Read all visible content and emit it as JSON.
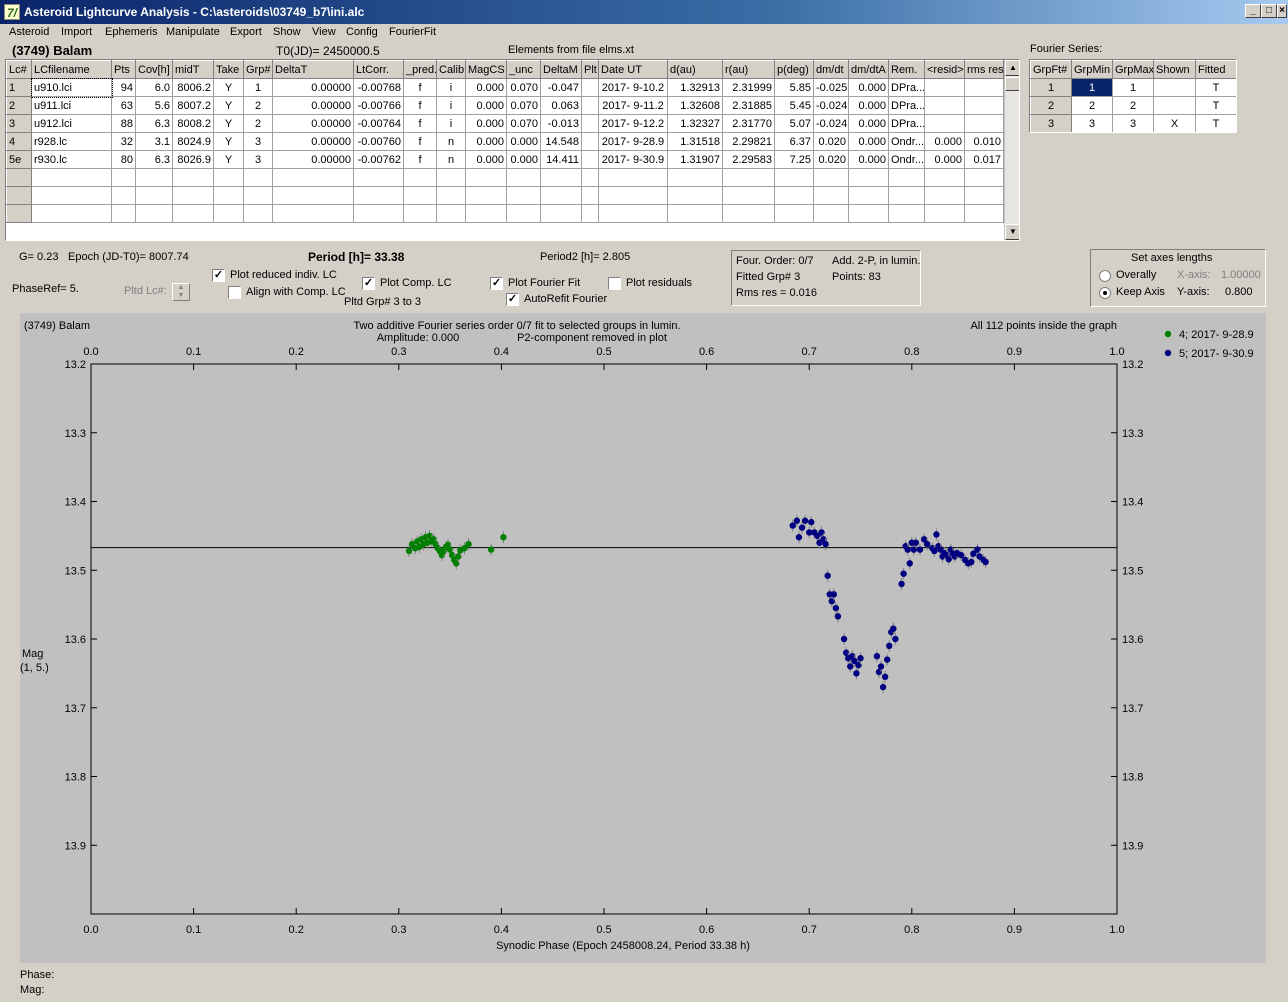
{
  "window": {
    "title": "Asteroid Lightcurve Analysis - C:\\asteroids\\03749_b7\\ini.alc",
    "icon_text": "7/"
  },
  "menu": [
    "Asteroid",
    "Import",
    "Ephemeris",
    "Manipulate",
    "Export",
    "Show",
    "View",
    "Config",
    "FourierFit"
  ],
  "header": {
    "asteroid_name": "(3749) Balam",
    "t0": "T0(JD)= 2450000.5",
    "elements": "Elements from file elms.xt"
  },
  "lc_table": {
    "columns": [
      "Lc#",
      "LCfilename",
      "Pts",
      "Cov[h]",
      "midT",
      "Take",
      "Grp#",
      "DeltaT",
      "LtCorr.",
      "_pred.",
      "Calib.",
      "MagCS",
      "_unc",
      "DeltaM",
      "Plt",
      "Date UT",
      "d(au)",
      "r(au)",
      "p(deg)",
      "dm/dt",
      "dm/dtA",
      "Rem.",
      "<resid>",
      "rms res"
    ],
    "rows": [
      [
        "1",
        "u910.lci",
        "94",
        "6.0",
        "8006.2",
        "Y",
        "1",
        "0.00000",
        "-0.00768",
        "f",
        "i",
        "0.000",
        "0.070",
        "-0.047",
        "",
        "2017- 9-10.2",
        "1.32913",
        "2.31999",
        "5.85",
        "-0.025",
        "0.000",
        "DPra...",
        "",
        ""
      ],
      [
        "2",
        "u911.lci",
        "63",
        "5.6",
        "8007.2",
        "Y",
        "2",
        "0.00000",
        "-0.00766",
        "f",
        "i",
        "0.000",
        "0.070",
        "0.063",
        "",
        "2017- 9-11.2",
        "1.32608",
        "2.31885",
        "5.45",
        "-0.024",
        "0.000",
        "DPra...",
        "",
        ""
      ],
      [
        "3",
        "u912.lci",
        "88",
        "6.3",
        "8008.2",
        "Y",
        "2",
        "0.00000",
        "-0.00764",
        "f",
        "i",
        "0.000",
        "0.070",
        "-0.013",
        "",
        "2017- 9-12.2",
        "1.32327",
        "2.31770",
        "5.07",
        "-0.024",
        "0.000",
        "DPra...",
        "",
        ""
      ],
      [
        "4",
        "r928.lc",
        "32",
        "3.1",
        "8024.9",
        "Y",
        "3",
        "0.00000",
        "-0.00760",
        "f",
        "n",
        "0.000",
        "0.000",
        "14.548",
        "",
        "2017- 9-28.9",
        "1.31518",
        "2.29821",
        "6.37",
        "0.020",
        "0.000",
        "Ondr...",
        "0.000",
        "0.010"
      ],
      [
        "5e",
        "r930.lc",
        "80",
        "6.3",
        "8026.9",
        "Y",
        "3",
        "0.00000",
        "-0.00762",
        "f",
        "n",
        "0.000",
        "0.000",
        "14.411",
        "",
        "2017- 9-30.9",
        "1.31907",
        "2.29583",
        "7.25",
        "0.020",
        "0.000",
        "Ondr...",
        "0.000",
        "0.017"
      ]
    ]
  },
  "fourier_series": {
    "label": "Fourier Series:",
    "columns": [
      "GrpFt#",
      "GrpMin",
      "GrpMax",
      "Shown",
      "Fitted"
    ],
    "rows": [
      [
        "1",
        "1",
        "1",
        "",
        "T"
      ],
      [
        "2",
        "2",
        "2",
        "",
        "T"
      ],
      [
        "3",
        "3",
        "3",
        "X",
        "T"
      ]
    ]
  },
  "params": {
    "g": "G= 0.23",
    "epoch": "Epoch (JD-T0)= 8007.74",
    "period": "Period [h]= 33.38",
    "period2": "Period2 [h]= 2.805",
    "phaseref": "PhaseRef= 5.",
    "pltd_lc": "Pltd Lc#:",
    "pltd_grp": "Pltd Grp#  3   to    3"
  },
  "options": {
    "plot_reduced": {
      "label": "Plot reduced indiv. LC",
      "checked": true
    },
    "align_comp": {
      "label": "Align with Comp. LC",
      "checked": false
    },
    "plot_comp": {
      "label": "Plot Comp. LC",
      "checked": true
    },
    "plot_fourier": {
      "label": "Plot Fourier Fit",
      "checked": true
    },
    "autorefit": {
      "label": "AutoRefit Fourier",
      "checked": true
    },
    "plot_residuals": {
      "label": "Plot residuals",
      "checked": false
    }
  },
  "fit_info": {
    "four_order": "Four. Order:  0/7",
    "add2p": "Add. 2-P, in lumin.",
    "fitted_grp": "Fitted Grp# 3",
    "points": "Points: 83",
    "rms": "Rms res      = 0.016"
  },
  "axes_box": {
    "title": "Set axes lengths",
    "overally": "Overally",
    "keep_axis": "Keep Axis",
    "xaxis_label": "X-axis:",
    "xaxis_value": "1.00000",
    "yaxis_label": "Y-axis:",
    "yaxis_value": "0.800"
  },
  "plot": {
    "corner_title": "(3749) Balam",
    "subtitle1": "Two additive Fourier series order 0/7 fit to selected groups in lumin.",
    "subtitle2a": "Amplitude: 0.000",
    "subtitle2b": "P2-component removed in plot",
    "points_note": "All 112 points inside the graph",
    "xlabel": "Synodic Phase (Epoch 2458008.24, Period 33.38 h)",
    "ylabel1": "Mag",
    "ylabel2": "(1, 5.)",
    "colors": {
      "green": "#008000",
      "navy": "#000080",
      "background": "#c0c0c0"
    }
  },
  "footer": {
    "phase": "Phase:",
    "mag": "Mag:"
  },
  "chart_data": {
    "type": "scatter",
    "xlabel": "Synodic Phase (Epoch 2458008.24, Period 33.38 h)",
    "ylabel": "Mag (1, 5.)",
    "xlim": [
      0.0,
      1.0
    ],
    "ylim": [
      13.2,
      14.0
    ],
    "y_inverted": true,
    "x_ticks": [
      "0.0",
      "0.1",
      "0.2",
      "0.3",
      "0.4",
      "0.5",
      "0.6",
      "0.7",
      "0.8",
      "0.9",
      "1.0"
    ],
    "y_ticks": [
      "13.2",
      "13.3",
      "13.4",
      "13.5",
      "13.6",
      "13.7",
      "13.8",
      "13.9"
    ],
    "fit_line_mag": 13.467,
    "legend_position": "top-right",
    "series": [
      {
        "name": "4; 2017- 9-28.9",
        "color": "#008000",
        "points": [
          [
            0.31,
            13.472
          ],
          [
            0.313,
            13.462
          ],
          [
            0.316,
            13.468
          ],
          [
            0.318,
            13.458
          ],
          [
            0.32,
            13.466
          ],
          [
            0.322,
            13.455
          ],
          [
            0.324,
            13.462
          ],
          [
            0.326,
            13.452
          ],
          [
            0.328,
            13.46
          ],
          [
            0.33,
            13.45
          ],
          [
            0.332,
            13.458
          ],
          [
            0.334,
            13.455
          ],
          [
            0.336,
            13.462
          ],
          [
            0.338,
            13.468
          ],
          [
            0.34,
            13.472
          ],
          [
            0.342,
            13.478
          ],
          [
            0.344,
            13.472
          ],
          [
            0.346,
            13.466
          ],
          [
            0.348,
            13.463
          ],
          [
            0.35,
            13.47
          ],
          [
            0.352,
            13.478
          ],
          [
            0.354,
            13.485
          ],
          [
            0.356,
            13.49
          ],
          [
            0.358,
            13.48
          ],
          [
            0.36,
            13.471
          ],
          [
            0.364,
            13.468
          ],
          [
            0.368,
            13.462
          ],
          [
            0.39,
            13.47
          ],
          [
            0.402,
            13.452
          ]
        ]
      },
      {
        "name": "5; 2017- 9-30.9",
        "color": "#000080",
        "points": [
          [
            0.684,
            13.435
          ],
          [
            0.688,
            13.428
          ],
          [
            0.69,
            13.452
          ],
          [
            0.693,
            13.438
          ],
          [
            0.696,
            13.428
          ],
          [
            0.7,
            13.445
          ],
          [
            0.702,
            13.43
          ],
          [
            0.705,
            13.445
          ],
          [
            0.708,
            13.45
          ],
          [
            0.71,
            13.46
          ],
          [
            0.712,
            13.445
          ],
          [
            0.714,
            13.455
          ],
          [
            0.716,
            13.462
          ],
          [
            0.718,
            13.508
          ],
          [
            0.72,
            13.535
          ],
          [
            0.722,
            13.545
          ],
          [
            0.724,
            13.535
          ],
          [
            0.726,
            13.555
          ],
          [
            0.728,
            13.567
          ],
          [
            0.734,
            13.6
          ],
          [
            0.736,
            13.62
          ],
          [
            0.738,
            13.628
          ],
          [
            0.74,
            13.64
          ],
          [
            0.742,
            13.625
          ],
          [
            0.744,
            13.632
          ],
          [
            0.746,
            13.65
          ],
          [
            0.748,
            13.638
          ],
          [
            0.75,
            13.628
          ],
          [
            0.766,
            13.625
          ],
          [
            0.768,
            13.648
          ],
          [
            0.77,
            13.64
          ],
          [
            0.772,
            13.67
          ],
          [
            0.774,
            13.655
          ],
          [
            0.776,
            13.63
          ],
          [
            0.778,
            13.61
          ],
          [
            0.78,
            13.59
          ],
          [
            0.782,
            13.585
          ],
          [
            0.784,
            13.6
          ],
          [
            0.79,
            13.52
          ],
          [
            0.792,
            13.505
          ],
          [
            0.794,
            13.465
          ],
          [
            0.796,
            13.47
          ],
          [
            0.798,
            13.49
          ],
          [
            0.8,
            13.46
          ],
          [
            0.802,
            13.47
          ],
          [
            0.804,
            13.46
          ],
          [
            0.808,
            13.47
          ],
          [
            0.812,
            13.455
          ],
          [
            0.815,
            13.462
          ],
          [
            0.82,
            13.468
          ],
          [
            0.822,
            13.472
          ],
          [
            0.824,
            13.448
          ],
          [
            0.826,
            13.465
          ],
          [
            0.828,
            13.47
          ],
          [
            0.83,
            13.48
          ],
          [
            0.832,
            13.475
          ],
          [
            0.834,
            13.478
          ],
          [
            0.836,
            13.484
          ],
          [
            0.838,
            13.47
          ],
          [
            0.84,
            13.476
          ],
          [
            0.842,
            13.48
          ],
          [
            0.844,
            13.475
          ],
          [
            0.848,
            13.478
          ],
          [
            0.852,
            13.485
          ],
          [
            0.855,
            13.49
          ],
          [
            0.858,
            13.488
          ],
          [
            0.86,
            13.476
          ],
          [
            0.864,
            13.47
          ],
          [
            0.866,
            13.48
          ],
          [
            0.87,
            13.485
          ],
          [
            0.872,
            13.488
          ]
        ]
      }
    ]
  }
}
